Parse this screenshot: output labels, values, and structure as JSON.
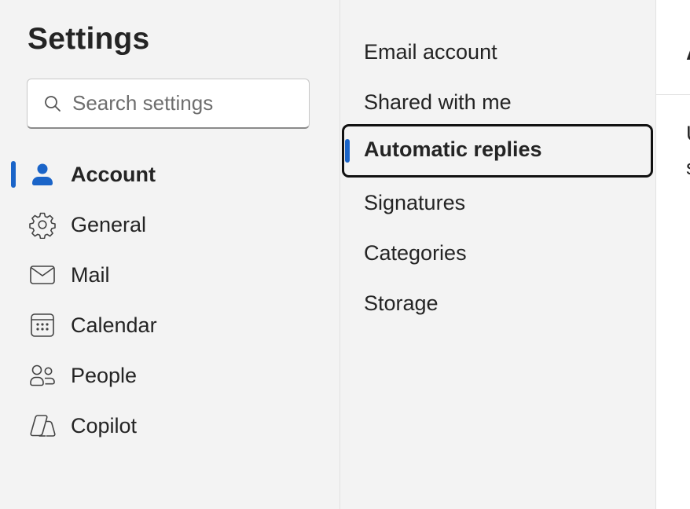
{
  "header": {
    "title": "Settings"
  },
  "search": {
    "placeholder": "Search settings"
  },
  "nav": {
    "items": [
      {
        "label": "Account",
        "icon": "person-icon",
        "active": true
      },
      {
        "label": "General",
        "icon": "gear-icon"
      },
      {
        "label": "Mail",
        "icon": "mail-icon"
      },
      {
        "label": "Calendar",
        "icon": "calendar-icon"
      },
      {
        "label": "People",
        "icon": "people-icon"
      },
      {
        "label": "Copilot",
        "icon": "copilot-icon"
      }
    ]
  },
  "subnav": {
    "items": [
      {
        "label": "Email account"
      },
      {
        "label": "Shared with me"
      },
      {
        "label": "Automatic replies",
        "selected": true
      },
      {
        "label": "Signatures"
      },
      {
        "label": "Categories"
      },
      {
        "label": "Storage"
      }
    ]
  },
  "content": {
    "title_fragment": "A",
    "line1_fragment": "U",
    "line2_fragment": "s"
  },
  "colors": {
    "accent": "#1a64c8",
    "pane_bg": "#f3f3f3",
    "content_bg": "#ffffff"
  }
}
